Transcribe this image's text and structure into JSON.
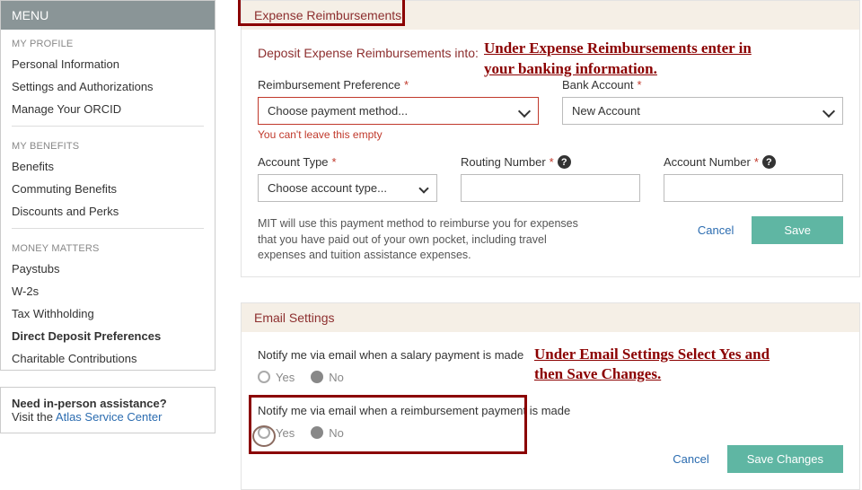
{
  "sidebar": {
    "menu_label": "MENU",
    "sections": {
      "profile": {
        "label": "MY PROFILE",
        "items": [
          "Personal Information",
          "Settings and Authorizations",
          "Manage Your ORCID"
        ]
      },
      "benefits": {
        "label": "MY BENEFITS",
        "items": [
          "Benefits",
          "Commuting Benefits",
          "Discounts and Perks"
        ]
      },
      "money": {
        "label": "MONEY MATTERS",
        "items": [
          "Paystubs",
          "W-2s",
          "Tax Withholding",
          "Direct Deposit Preferences",
          "Charitable Contributions"
        ],
        "active_index": 3
      }
    },
    "assist": {
      "q": "Need in-person assistance?",
      "prefix": "Visit the ",
      "link": "Atlas Service Center"
    }
  },
  "expense": {
    "header": "Expense Reimbursements",
    "deposit_into": "Deposit Expense Reimbursements into:",
    "annotation": "Under Expense Reimbursements enter in your banking information.",
    "pref": {
      "label": "Reimbursement Preference",
      "placeholder": "Choose payment method...",
      "error": "You can't leave this empty"
    },
    "bank": {
      "label": "Bank Account",
      "placeholder": "New Account"
    },
    "acct_type": {
      "label": "Account Type",
      "placeholder": "Choose account type..."
    },
    "routing": {
      "label": "Routing Number"
    },
    "acct_num": {
      "label": "Account Number"
    },
    "note": "MIT will use this payment method to reimburse you for expenses that you have paid out of your own pocket, including travel expenses and tuition assistance expenses.",
    "cancel": "Cancel",
    "save": "Save"
  },
  "email": {
    "header": "Email Settings",
    "annotation": "Under Email Settings Select Yes and then Save Changes.",
    "q_salary": "Notify me via email when a salary payment is made",
    "q_reimb": "Notify me via email when a reimbursement payment is made",
    "yes": "Yes",
    "no": "No",
    "cancel": "Cancel",
    "save": "Save Changes"
  }
}
